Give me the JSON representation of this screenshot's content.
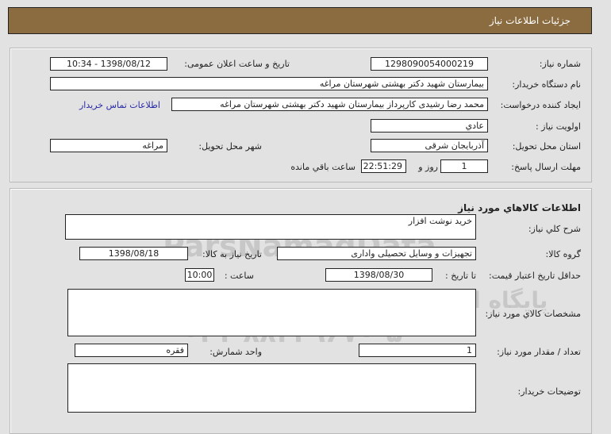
{
  "header": {
    "title": "جزئیات اطلاعات نیاز"
  },
  "need_info": {
    "need_number_label": "شماره نیاز:",
    "need_number": "1298090054000219",
    "announce_label": "تاریخ و ساعت اعلان عمومی:",
    "announce_value": "1398/08/12 - 10:34",
    "buyer_org_label": "نام دستگاه خریدار:",
    "buyer_org": "بیمارستان شهید دکتر بهشتی شهرستان مراغه",
    "creator_label": "ایجاد کننده درخواست:",
    "creator": "محمد رضا رشیدی کارپرداز بیمارستان شهید دکتر بهشتی شهرستان مراغه",
    "contact_link": "اطلاعات تماس خریدار",
    "priority_label": "اولویت نیاز :",
    "priority": "عادي",
    "province_label": "استان محل تحویل:",
    "province": "آذربایجان شرقی",
    "city_label": "شهر محل تحویل:",
    "city": "مراغه",
    "deadline_label": "مهلت ارسال پاسخ:",
    "days": "1",
    "days_suffix": "روز و",
    "time_left": "22:51:29",
    "time_suffix": "ساعت باقي مانده"
  },
  "goods": {
    "title": "اطلاعات کالاهاي مورد نیاز",
    "desc_label": "شرح کلي نیاز:",
    "desc": "خرید نوشت افزار",
    "group_label": "گروه کالا:",
    "group": "تجهیزات و وسایل تحصیلی واداری",
    "need_date_label": "تاریخ نیاز به کالا:",
    "need_date": "1398/08/18",
    "validity_label": "حداقل تاریخ اعتبار قیمت:",
    "to_date_label": "تا تاریخ :",
    "to_date": "1398/08/30",
    "hour_label": "ساعت :",
    "hour": "10:00",
    "specs_label": "مشخصات کالاي مورد نیاز:",
    "specs": "",
    "qty_label": "تعداد / مقدار مورد نیاز:",
    "qty": "1",
    "unit_label": "واحد شمارش:",
    "unit": "فقره",
    "buyer_notes_label": "توضیحات خریدار:",
    "buyer_notes": ""
  },
  "watermark": {
    "brand": "ParsNamadData",
    "line1": "پایگاه اطلاع رسانی مناقصه ومزایده",
    "line2": "۰۲۱-۸۸۳۴۹۶۷۰-۵"
  }
}
